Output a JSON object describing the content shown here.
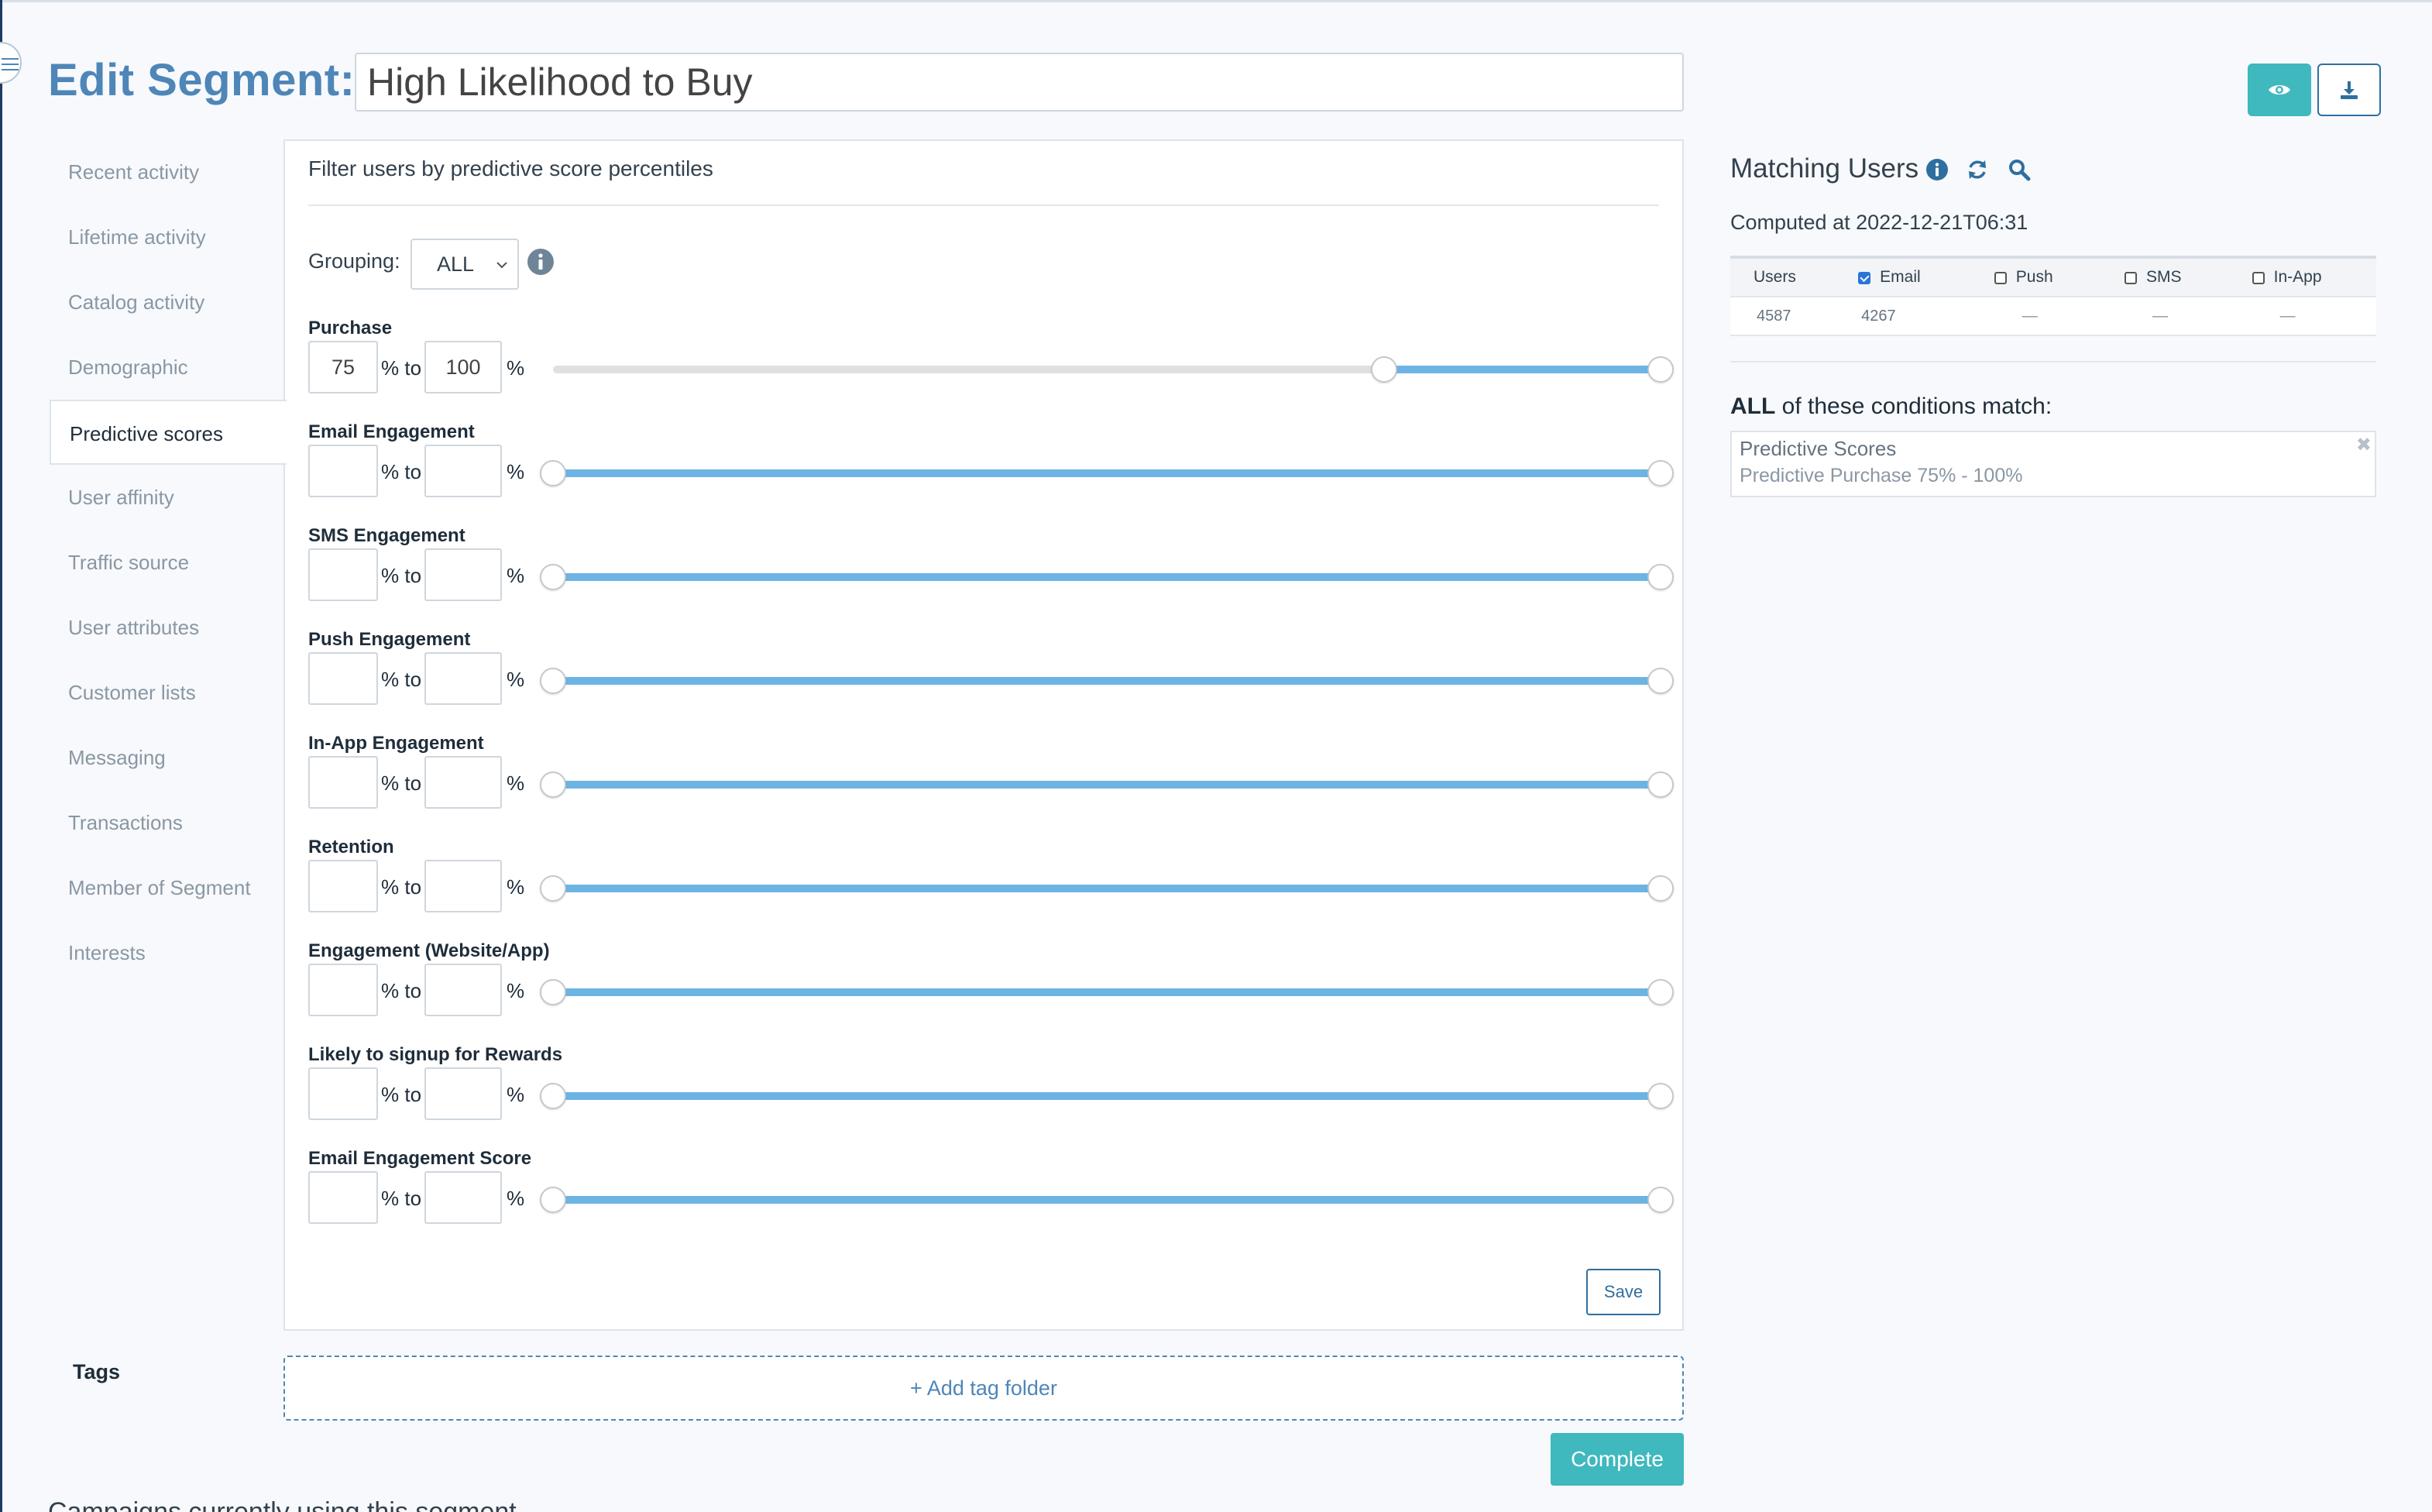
{
  "header": {
    "title": "Edit Segment:",
    "segment_name": "High Likelihood to Buy"
  },
  "sidebar": {
    "items": [
      {
        "label": "Recent activity",
        "active": false
      },
      {
        "label": "Lifetime activity",
        "active": false
      },
      {
        "label": "Catalog activity",
        "active": false
      },
      {
        "label": "Demographic",
        "active": false
      },
      {
        "label": "Predictive scores",
        "active": true
      },
      {
        "label": "User affinity",
        "active": false
      },
      {
        "label": "Traffic source",
        "active": false
      },
      {
        "label": "User attributes",
        "active": false
      },
      {
        "label": "Customer lists",
        "active": false
      },
      {
        "label": "Messaging",
        "active": false
      },
      {
        "label": "Transactions",
        "active": false
      },
      {
        "label": "Member of Segment",
        "active": false
      },
      {
        "label": "Interests",
        "active": false
      }
    ]
  },
  "panel": {
    "heading": "Filter users by predictive score percentiles",
    "grouping_label": "Grouping:",
    "grouping_value": "ALL",
    "to_label": "% to",
    "pct_label": "%",
    "scores": [
      {
        "label": "Purchase",
        "from": "75",
        "to": "100",
        "range": [
          75,
          100
        ]
      },
      {
        "label": "Email Engagement",
        "from": "",
        "to": "",
        "range": [
          0,
          100
        ]
      },
      {
        "label": "SMS Engagement",
        "from": "",
        "to": "",
        "range": [
          0,
          100
        ]
      },
      {
        "label": "Push Engagement",
        "from": "",
        "to": "",
        "range": [
          0,
          100
        ]
      },
      {
        "label": "In-App Engagement",
        "from": "",
        "to": "",
        "range": [
          0,
          100
        ]
      },
      {
        "label": "Retention",
        "from": "",
        "to": "",
        "range": [
          0,
          100
        ]
      },
      {
        "label": "Engagement (Website/App)",
        "from": "",
        "to": "",
        "range": [
          0,
          100
        ]
      },
      {
        "label": "Likely to signup for Rewards",
        "from": "",
        "to": "",
        "range": [
          0,
          100
        ]
      },
      {
        "label": "Email Engagement Score",
        "from": "",
        "to": "",
        "range": [
          0,
          100
        ]
      }
    ],
    "save_label": "Save"
  },
  "tags": {
    "label": "Tags",
    "add_folder": "+ Add tag folder"
  },
  "complete_label": "Complete",
  "bottom_text": "Campaigns currently using this segment",
  "matching": {
    "title": "Matching Users",
    "computed": "Computed at 2022-12-21T06:31",
    "columns": [
      {
        "label": "Users",
        "checkbox": false
      },
      {
        "label": "Email",
        "checkbox": true,
        "checked": true
      },
      {
        "label": "Push",
        "checkbox": true,
        "checked": false
      },
      {
        "label": "SMS",
        "checkbox": true,
        "checked": false
      },
      {
        "label": "In-App",
        "checkbox": true,
        "checked": false
      }
    ],
    "values": [
      "4587",
      "4267",
      "—",
      "—",
      "—"
    ]
  },
  "conditions": {
    "lead": "ALL",
    "rest": " of these conditions match:",
    "item_title": "Predictive Scores",
    "item_detail": "Predictive Purchase 75% - 100%",
    "remove_glyph": "✖"
  },
  "colors": {
    "accent": "#3fb8be",
    "title_blue": "#4e86b8",
    "slider_fill": "#6cb4e4",
    "link_blue": "#2f6f9f"
  }
}
